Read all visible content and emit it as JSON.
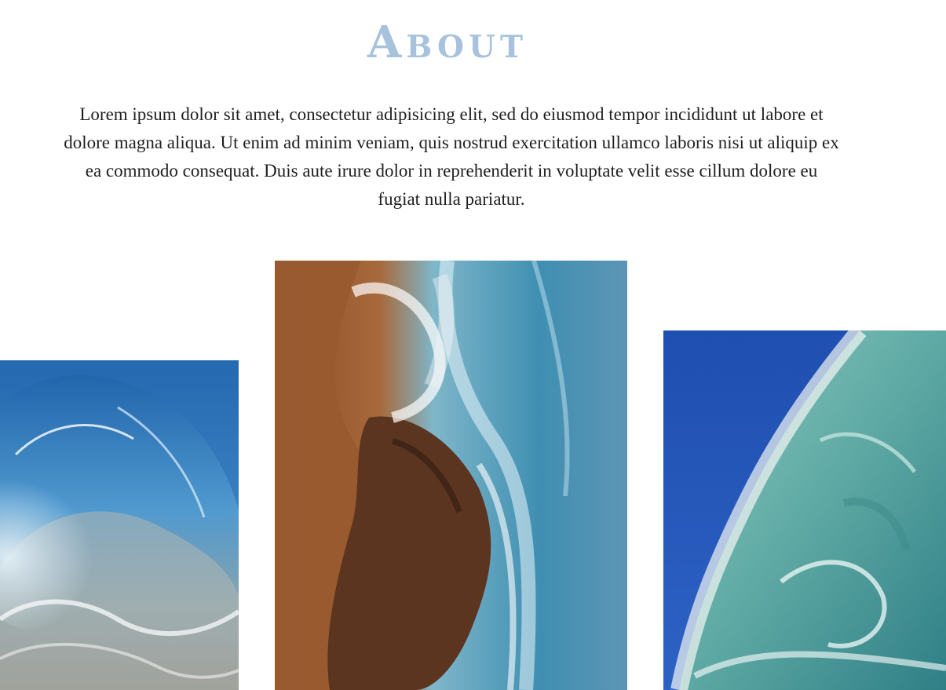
{
  "about": {
    "title": "About",
    "body": "Lorem ipsum dolor sit amet, consectetur adipisicing elit, sed do eiusmod tempor incididunt ut labore et dolore magna aliqua. Ut enim ad minim veniam, quis nostrud exercitation ullamco laboris nisi ut aliquip ex ea commodo consequat. Duis aute irure dolor in reprehenderit in voluptate velit esse cillum dolore eu fugiat nulla pariatur."
  },
  "gallery": {
    "images": [
      {
        "name": "wave-painting-left",
        "subject": "curling blue ocean wave"
      },
      {
        "name": "wave-painting-center",
        "subject": "aerial view of waves crashing on rocks and sand"
      },
      {
        "name": "wave-painting-right",
        "subject": "turquoise wave breaking against deep blue sky"
      }
    ]
  },
  "colors": {
    "title": "#a7c2dc",
    "text": "#1f1f1f",
    "background": "#ffffff"
  }
}
